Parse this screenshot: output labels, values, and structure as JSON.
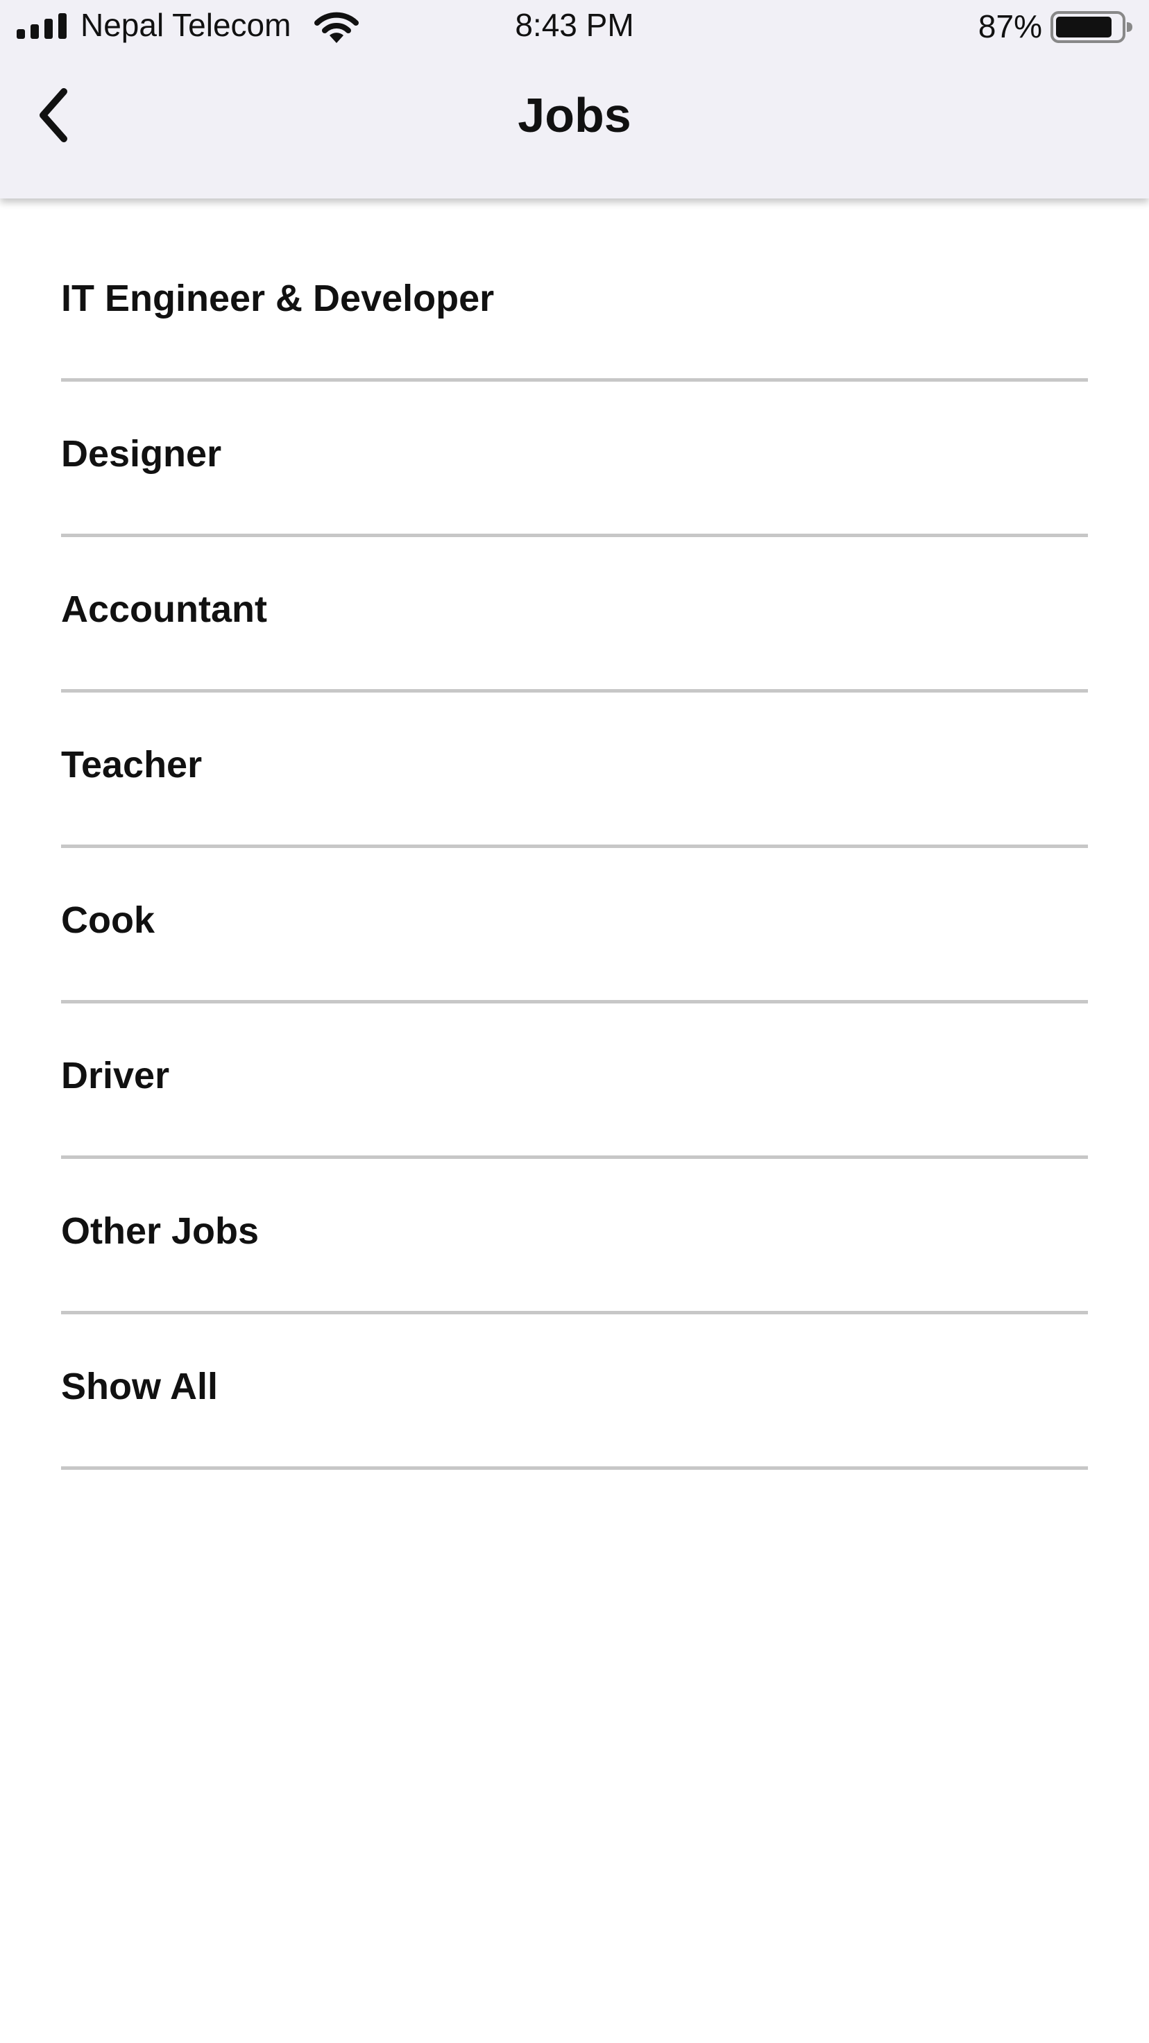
{
  "status_bar": {
    "carrier": "Nepal Telecom",
    "time": "8:43 PM",
    "battery_percent": "87%",
    "battery_level": 0.87,
    "signal_icon": "signal-bars-icon",
    "wifi_icon": "wifi-icon",
    "battery_icon": "battery-icon"
  },
  "nav": {
    "title": "Jobs",
    "back_icon": "chevron-left-icon"
  },
  "jobs": {
    "items": [
      {
        "label": "IT Engineer & Developer"
      },
      {
        "label": "Designer"
      },
      {
        "label": "Accountant"
      },
      {
        "label": "Teacher"
      },
      {
        "label": "Cook"
      },
      {
        "label": "Driver"
      },
      {
        "label": "Other Jobs"
      },
      {
        "label": "Show All"
      }
    ]
  },
  "colors": {
    "header_background": "#f1f0f6",
    "divider": "#c7c7c7",
    "text": "#111111",
    "background": "#ffffff"
  }
}
